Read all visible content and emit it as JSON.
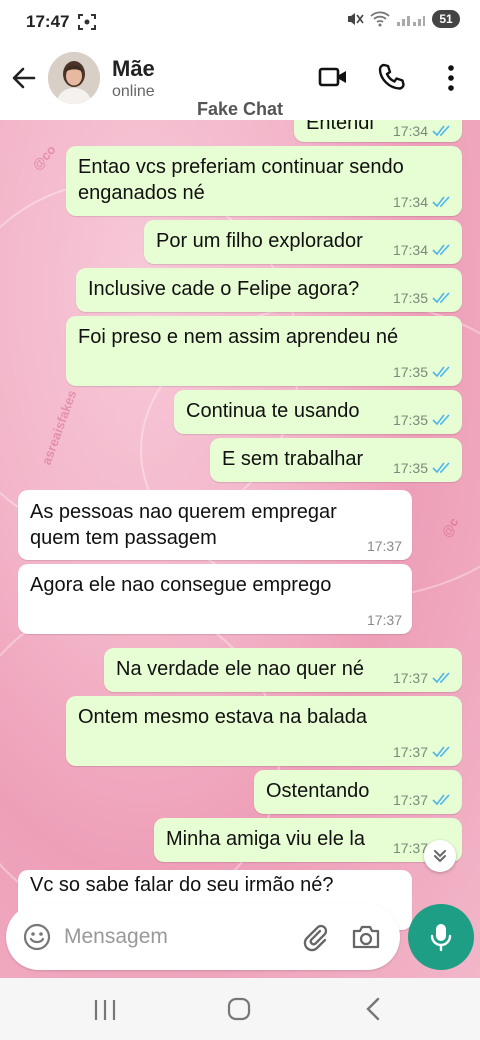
{
  "status_bar": {
    "time": "17:47",
    "battery": "51"
  },
  "header": {
    "contact_name": "Mãe",
    "contact_status": "online",
    "watermark": "Fake Chat"
  },
  "messages": [
    {
      "direction": "out",
      "text": "Entendi",
      "time": "17:34",
      "status": "read"
    },
    {
      "direction": "out",
      "text": "Entao vcs preferiam continuar sendo",
      "text2": "enganados né",
      "time": "17:34",
      "status": "read"
    },
    {
      "direction": "out",
      "text": "Por um filho explorador",
      "time": "17:34",
      "status": "read"
    },
    {
      "direction": "out",
      "text": "Inclusive cade o Felipe agora?",
      "time": "17:35",
      "status": "read"
    },
    {
      "direction": "out",
      "text": "Foi preso e nem assim aprendeu né",
      "time": "17:35",
      "status": "read"
    },
    {
      "direction": "out",
      "text": "Continua te usando",
      "time": "17:35",
      "status": "read"
    },
    {
      "direction": "out",
      "text": "E sem trabalhar",
      "time": "17:35",
      "status": "read"
    },
    {
      "direction": "in",
      "text": "As pessoas nao querem empregar",
      "text2": "quem tem passagem",
      "time": "17:37"
    },
    {
      "direction": "in",
      "text": "Agora ele nao consegue emprego",
      "time": "17:37"
    },
    {
      "direction": "out",
      "text": "Na verdade ele nao quer né",
      "time": "17:37",
      "status": "read"
    },
    {
      "direction": "out",
      "text": "Ontem mesmo estava na balada",
      "time": "17:37",
      "status": "read"
    },
    {
      "direction": "out",
      "text": "Ostentando",
      "time": "17:37",
      "status": "read"
    },
    {
      "direction": "out",
      "text": "Minha amiga viu ele la",
      "time": "17:37",
      "status": "read"
    },
    {
      "direction": "in",
      "text": "Vc so sabe falar do seu irmão né?"
    }
  ],
  "composer": {
    "placeholder": "Mensagem"
  },
  "icons": {
    "back": "arrow-left-icon",
    "video": "video-camera-icon",
    "call": "phone-icon",
    "menu": "more-vertical-icon",
    "emoji": "emoji-icon",
    "attach": "paperclip-icon",
    "camera": "camera-icon",
    "mic": "microphone-icon",
    "scroll_down": "double-chevron-down-icon"
  },
  "colors": {
    "outgoing_bubble": "#e7fdd3",
    "incoming_bubble": "#ffffff",
    "read_ticks": "#4fb6ec",
    "mic_button": "#1e9e85",
    "chat_background": "#f3b5c9"
  }
}
